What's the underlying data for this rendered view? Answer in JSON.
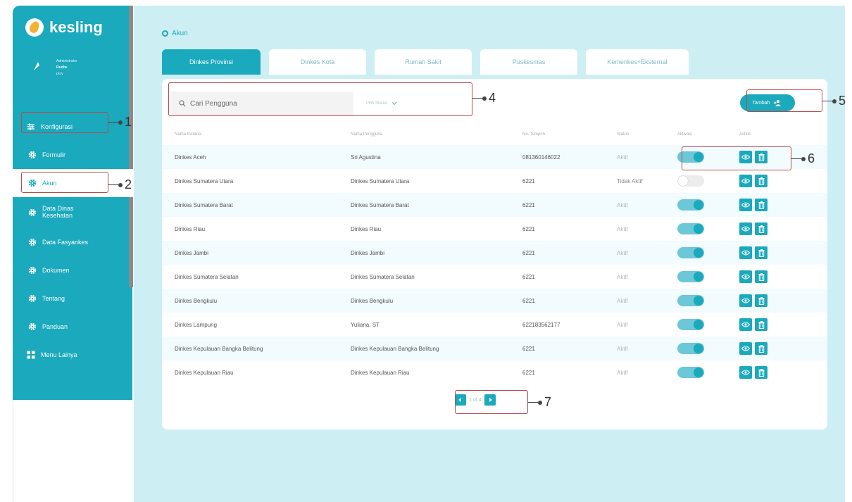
{
  "app": {
    "logo_text": "kesling"
  },
  "profile": {
    "line1": "Administrator",
    "line2": "Rudhe",
    "line3": "prov"
  },
  "sidebar": {
    "items": [
      {
        "label": "Konfigurasi",
        "icon": "sliders-icon"
      },
      {
        "label": "Formulir",
        "icon": "gear-icon"
      },
      {
        "label": "Akun",
        "icon": "gear-icon"
      },
      {
        "label": "Data Dinas Kesehatan",
        "icon": "gear-icon"
      },
      {
        "label": "Data Fasyankes",
        "icon": "gear-icon"
      },
      {
        "label": "Dokumen",
        "icon": "gear-icon"
      },
      {
        "label": "Tentang",
        "icon": "gear-icon"
      },
      {
        "label": "Panduan",
        "icon": "gear-icon"
      },
      {
        "label": "Menu Lainya",
        "icon": "grid-icon"
      }
    ]
  },
  "breadcrumb": {
    "label": "Akun"
  },
  "tabs": [
    {
      "label": "Dinkes Provinsi",
      "active": true
    },
    {
      "label": "Dinkes Kota",
      "active": false
    },
    {
      "label": "Rumah Sakit",
      "active": false
    },
    {
      "label": "Puskesmas",
      "active": false
    },
    {
      "label": "Kemenkes+Eksternal",
      "active": false
    }
  ],
  "search": {
    "placeholder": "Cari Pengguna",
    "filter_value": "Pilih Status"
  },
  "add_button": {
    "label": "Tambah"
  },
  "table": {
    "headers": [
      "Nama Instansi",
      "Nama Pengguna",
      "No. Telepon",
      "Status",
      "Aktivasi",
      "Action"
    ],
    "rows": [
      {
        "instansi": "Dinkes Aceh",
        "pengguna": "Sri Agustina",
        "telepon": "081360146022",
        "status": "Aktif",
        "active": true
      },
      {
        "instansi": "Dinkes Sumatera Utara",
        "pengguna": "Dinkes Sumatera Utara",
        "telepon": "6221",
        "status": "Tidak Aktif",
        "active": false
      },
      {
        "instansi": "Dinkes Sumatera Barat",
        "pengguna": "Dinkes Sumatera Barat",
        "telepon": "6221",
        "status": "Aktif",
        "active": true
      },
      {
        "instansi": "Dinkes Riau",
        "pengguna": "Dinkes Riau",
        "telepon": "6221",
        "status": "Aktif",
        "active": true
      },
      {
        "instansi": "Dinkes Jambi",
        "pengguna": "Dinkes Jambi",
        "telepon": "6221",
        "status": "Aktif",
        "active": true
      },
      {
        "instansi": "Dinkes Sumatera Selatan",
        "pengguna": "Dinkes Sumatera Selatan",
        "telepon": "6221",
        "status": "Aktif",
        "active": true
      },
      {
        "instansi": "Dinkes Bengkulu",
        "pengguna": "Dinkes Bengkulu",
        "telepon": "6221",
        "status": "Aktif",
        "active": true
      },
      {
        "instansi": "Dinkes Lampung",
        "pengguna": "Yuliana, ST",
        "telepon": "622183562177",
        "status": "Aktif",
        "active": true
      },
      {
        "instansi": "Dinkes Kepulauan Bangka Belitung",
        "pengguna": "Dinkes Kepulauan Bangka Belitung",
        "telepon": "6221",
        "status": "Aktif",
        "active": true
      },
      {
        "instansi": "Dinkes Kepulauan Riau",
        "pengguna": "Dinkes Kepulauan Riau",
        "telepon": "6221",
        "status": "Aktif",
        "active": true
      }
    ]
  },
  "pagination": {
    "label": "1 of 4"
  },
  "callouts": [
    "1",
    "2",
    "4",
    "5",
    "6",
    "7"
  ],
  "colors": {
    "primary": "#1aa9bd",
    "background": "#cdeff4",
    "annotation": "#b24d4d"
  }
}
